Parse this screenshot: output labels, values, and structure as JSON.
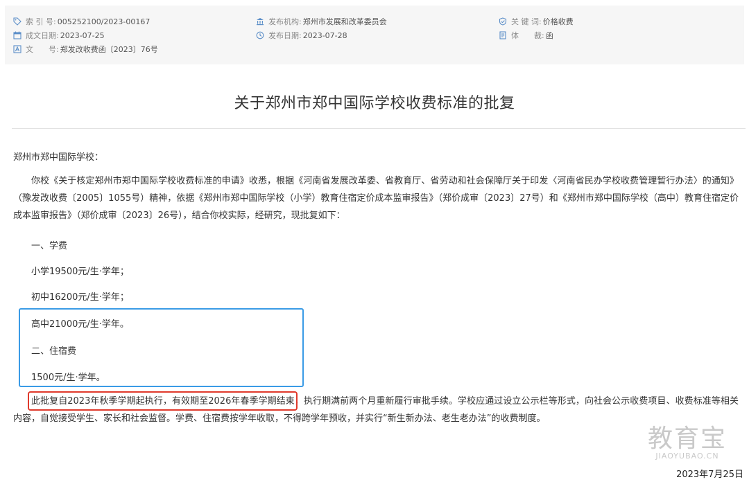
{
  "meta": {
    "index": {
      "label": "索 引 号:",
      "value": "005252100/2023-00167",
      "icon": "tag-icon"
    },
    "issuer": {
      "label": "发布机构:",
      "value": "郑州市发展和改革委员会",
      "icon": "institution-icon"
    },
    "keywords": {
      "label": "关 键 词:",
      "value": "价格收费",
      "icon": "shield-check-icon"
    },
    "created": {
      "label": "成文日期:",
      "value": "2023-07-25",
      "icon": "calendar-icon"
    },
    "published": {
      "label": "发布日期:",
      "value": "2023-07-28",
      "icon": "clock-icon"
    },
    "genre": {
      "label": "体　　裁:",
      "value": "函",
      "icon": "document-icon"
    },
    "docno": {
      "label": "文　　号:",
      "value": "郑发改收费函〔2023〕76号",
      "icon": "text-icon"
    }
  },
  "title": "关于郑州市郑中国际学校收费标准的批复",
  "salutation": "郑州市郑中国际学校：",
  "paragraph1": "你校《关于核定郑州市郑中国际学校收费标准的申请》收悉，根据《河南省发展改革委、省教育厅、省劳动和社会保障厅关于印发〈河南省民办学校收费管理暂行办法〉的通知》（豫发改收费〔2005〕1055号）精神，依据《郑州市郑中国际学校（小学）教育住宿定价成本监审报告》（郑价成审〔2023〕27号）和《郑州市郑中国际学校（高中）教育住宿定价成本监审报告》（郑价成审〔2023〕26号），结合你校实际，经研究，现批复如下：",
  "items": {
    "tuition_heading": "一、学费",
    "primary": "小学19500元/生·学年；",
    "junior": "初中16200元/生·学年；",
    "senior": "高中21000元/生·学年。",
    "lodging_heading": "二、住宿费",
    "lodging": "1500元/生·学年。"
  },
  "closing": {
    "highlight": "此批复自2023年秋季学期起执行，有效期至2026年春季学期结束，",
    "rest": "执行期满前两个月重新履行审批手续。学校应通过设立公示栏等形式，向社会公示收费项目、收费标准等相关内容，自觉接受学生、家长和社会监督。学费、住宿费按学年收取，不得跨学年预收，并实行“新生新办法、老生老办法”的收费制度。"
  },
  "watermark": {
    "cn": "教育宝",
    "en": "JIAOYUBAO.CN"
  },
  "bottom_date": "2023年7月25日",
  "colors": {
    "highlight_box_blue": "#3a9be6",
    "highlight_box_red": "#e03a2c",
    "icon_blue": "#5b8ec8"
  }
}
